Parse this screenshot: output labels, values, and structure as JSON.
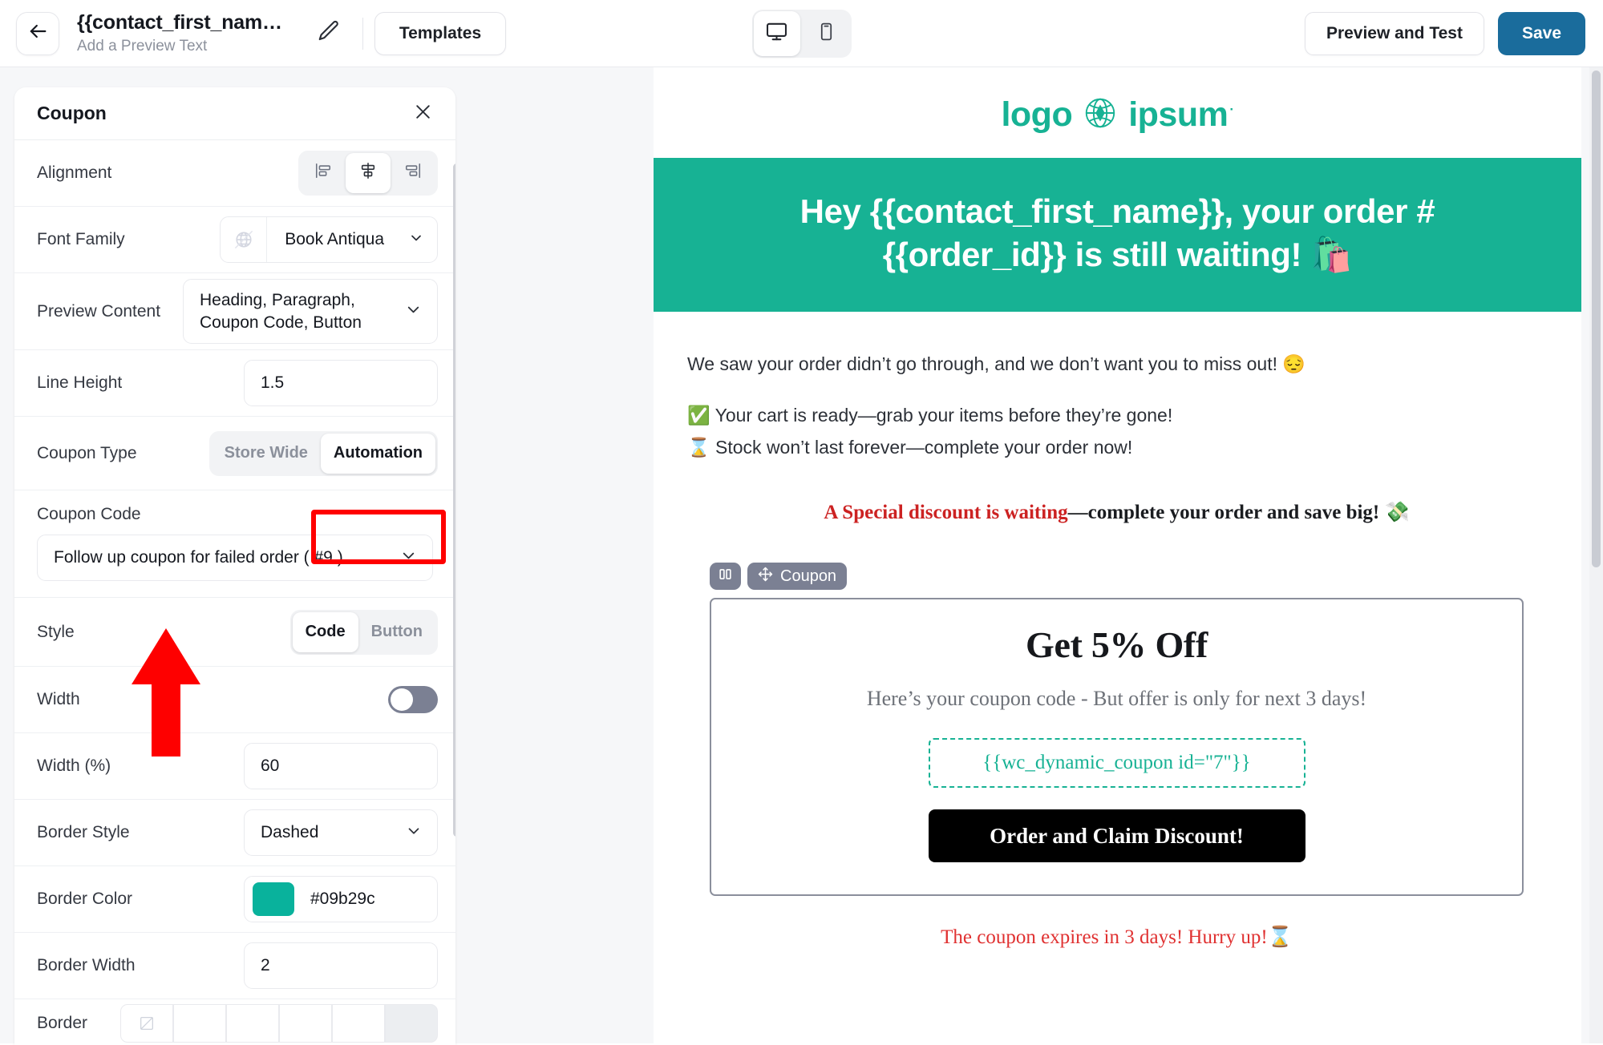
{
  "topbar": {
    "back_icon": "arrow-left-icon",
    "title": "{{contact_first_nam…",
    "subtitle": "Add a Preview Text",
    "edit_icon": "pencil-icon",
    "templates_label": "Templates",
    "desktop_icon": "desktop-icon",
    "mobile_icon": "mobile-icon",
    "preview_label": "Preview and Test",
    "save_label": "Save",
    "save_color": "#1a6c9c"
  },
  "panel": {
    "title": "Coupon",
    "close_icon": "close-icon",
    "rows": {
      "alignment": {
        "label": "Alignment",
        "options": [
          "align-left-icon",
          "align-center-icon",
          "align-right-icon"
        ],
        "selected": "align-center-icon"
      },
      "font_family": {
        "label": "Font Family",
        "icon": "globe-disabled-icon",
        "value": "Book Antiqua",
        "caret": "chevron-down-icon"
      },
      "preview_content": {
        "label": "Preview Content",
        "value": "Heading, Paragraph, Coupon Code, Button",
        "caret": "chevron-down-icon"
      },
      "line_height": {
        "label": "Line Height",
        "value": "1.5"
      },
      "coupon_type": {
        "label": "Coupon Type",
        "options": [
          "Store Wide",
          "Automation"
        ],
        "selected": "Automation"
      },
      "coupon_code": {
        "label": "Coupon Code",
        "value": "Follow up coupon for failed order ( #9 )",
        "caret": "chevron-down-icon"
      },
      "style": {
        "label": "Style",
        "options": [
          "Code",
          "Button"
        ],
        "selected": "Code"
      },
      "width_toggle": {
        "label": "Width",
        "state": "off"
      },
      "width_percent": {
        "label": "Width (%)",
        "value": "60"
      },
      "border_style": {
        "label": "Border Style",
        "value": "Dashed",
        "caret": "chevron-down-icon"
      },
      "border_color": {
        "label": "Border Color",
        "value": "#09b29c",
        "swatch": "#09b29c"
      },
      "border_width": {
        "label": "Border Width",
        "value": "2"
      },
      "border": {
        "label": "Border"
      }
    }
  },
  "annotations": {
    "highlight_box_color": "#ff0000",
    "arrow_color": "#fe0000",
    "highlight_target": "Automation",
    "arrow_target": "Follow up coupon for failed order ( #9 )"
  },
  "email": {
    "logo_text_left": "logo",
    "logo_icon": "globe-diamond-icon",
    "logo_text_right": "ipsum",
    "logo_tm": "·",
    "logo_color": "#17b294",
    "hero_line1": "Hey {{contact_first_name}}, your order #",
    "hero_line2": "{{order_id}} is still waiting! 🛍️",
    "hero_bg": "#17b294",
    "para1": "We saw your order didn’t go through, and we don’t want you to miss out! 😔",
    "bullet1": "✅ Your cart is ready—grab your items before they’re gone!",
    "bullet2": "⌛ Stock won’t last forever—complete your order now!",
    "special_red": "A Special discount is waiting",
    "special_black": "—complete your order and save big! 💸",
    "toolbar": {
      "columns_icon": "columns-icon",
      "move_icon": "move-icon",
      "block_label": "Coupon"
    },
    "coupon": {
      "heading": "Get 5% Off",
      "subtext": "Here’s your coupon code - But offer is only for next 3 days!",
      "code": "{{wc_dynamic_coupon id=\"7\"}}",
      "code_border_color": "#17b294",
      "cta_label": "Order and Claim Discount!"
    },
    "expiry": "The coupon expires in 3 days! Hurry up!⌛",
    "expiry_color": "#e03131"
  }
}
